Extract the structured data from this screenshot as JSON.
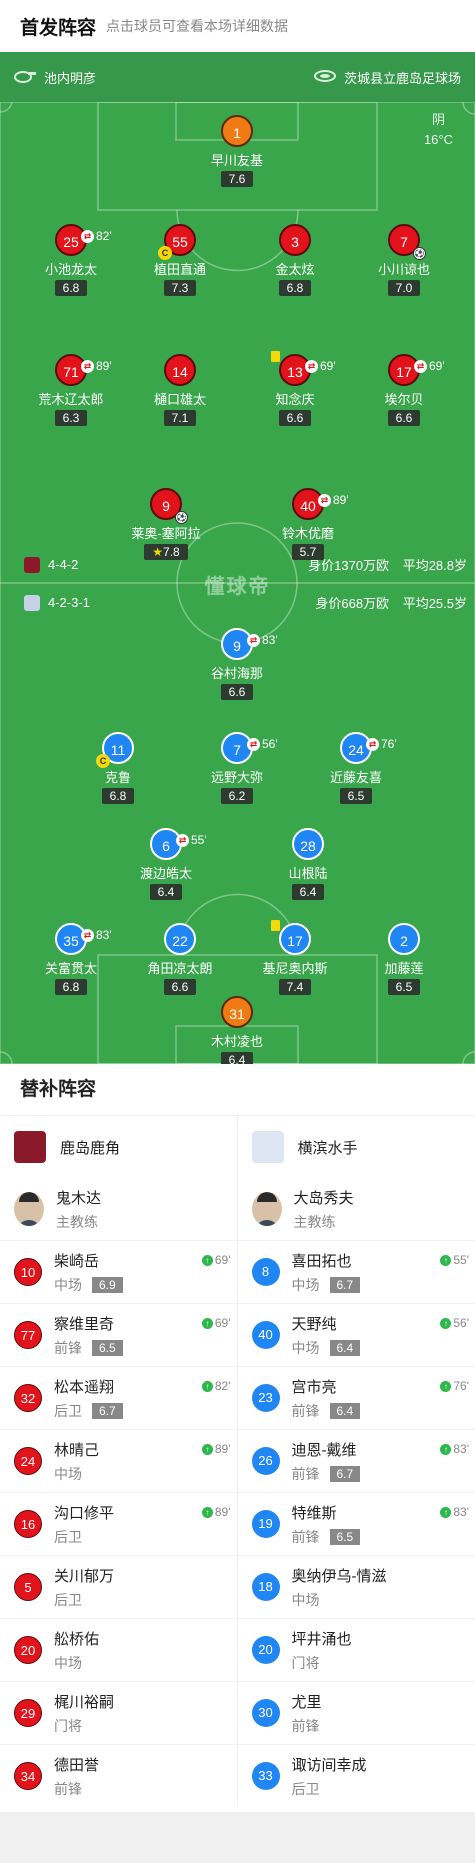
{
  "header": {
    "title": "首发阵容",
    "subtitle": "点击球员可查看本场详细数据"
  },
  "venue": {
    "referee": "池内明彦",
    "stadium": "茨城县立鹿岛足球场"
  },
  "weather": {
    "condition": "阴",
    "temp": "16°C"
  },
  "watermark": "懂球帝",
  "home_form": {
    "formation": "4-4-2",
    "value": "身价1370万欧",
    "age": "平均28.8岁"
  },
  "away_form": {
    "formation": "4-2-3-1",
    "value": "身价668万欧",
    "age": "平均25.5岁"
  },
  "home_players": [
    {
      "num": "1",
      "name": "早川友基",
      "rating": "7.6",
      "sub": ""
    },
    {
      "num": "25",
      "name": "小池龙太",
      "rating": "6.8",
      "sub": "82'"
    },
    {
      "num": "55",
      "name": "植田直通",
      "rating": "7.3",
      "sub": ""
    },
    {
      "num": "3",
      "name": "金太炫",
      "rating": "6.8",
      "sub": ""
    },
    {
      "num": "7",
      "name": "小川谅也",
      "rating": "7.0",
      "sub": ""
    },
    {
      "num": "71",
      "name": "荒木辽太郎",
      "rating": "6.3",
      "sub": "89'"
    },
    {
      "num": "14",
      "name": "樋口雄太",
      "rating": "7.1",
      "sub": ""
    },
    {
      "num": "13",
      "name": "知念庆",
      "rating": "6.6",
      "sub": "69'"
    },
    {
      "num": "17",
      "name": "埃尔贝",
      "rating": "6.6",
      "sub": "69'"
    },
    {
      "num": "9",
      "name": "莱奥-塞阿拉",
      "rating": "7.8",
      "sub": ""
    },
    {
      "num": "40",
      "name": "铃木优磨",
      "rating": "5.7",
      "sub": "89'"
    }
  ],
  "away_players": [
    {
      "num": "9",
      "name": "谷村海那",
      "rating": "6.6",
      "sub": "83'"
    },
    {
      "num": "11",
      "name": "克鲁",
      "rating": "6.8",
      "sub": ""
    },
    {
      "num": "7",
      "name": "远野大弥",
      "rating": "6.2",
      "sub": "56'"
    },
    {
      "num": "24",
      "name": "近藤友喜",
      "rating": "6.5",
      "sub": "76'"
    },
    {
      "num": "6",
      "name": "渡边皓太",
      "rating": "6.4",
      "sub": "55'"
    },
    {
      "num": "28",
      "name": "山根陆",
      "rating": "6.4",
      "sub": ""
    },
    {
      "num": "35",
      "name": "关富贯太",
      "rating": "6.8",
      "sub": "83'"
    },
    {
      "num": "22",
      "name": "角田凉太朗",
      "rating": "6.6",
      "sub": ""
    },
    {
      "num": "17",
      "name": "基尼奥内斯",
      "rating": "7.4",
      "sub": ""
    },
    {
      "num": "2",
      "name": "加藤莲",
      "rating": "6.5",
      "sub": ""
    },
    {
      "num": "31",
      "name": "木村凌也",
      "rating": "6.4",
      "sub": ""
    }
  ],
  "subs": {
    "title": "替补阵容",
    "home": {
      "team": "鹿岛鹿角",
      "coach": {
        "name": "鬼木达",
        "role": "主教练"
      },
      "players": [
        {
          "num": "10",
          "name": "柴崎岳",
          "pos": "中场",
          "rating": "6.9",
          "in": "69'"
        },
        {
          "num": "77",
          "name": "察维里奇",
          "pos": "前锋",
          "rating": "6.5",
          "in": "69'"
        },
        {
          "num": "32",
          "name": "松本遥翔",
          "pos": "后卫",
          "rating": "6.7",
          "in": "82'"
        },
        {
          "num": "24",
          "name": "林晴己",
          "pos": "中场",
          "rating": "",
          "in": "89'"
        },
        {
          "num": "16",
          "name": "沟口修平",
          "pos": "后卫",
          "rating": "",
          "in": "89'"
        },
        {
          "num": "5",
          "name": "关川郁万",
          "pos": "后卫",
          "rating": "",
          "in": ""
        },
        {
          "num": "20",
          "name": "舩桥佑",
          "pos": "中场",
          "rating": "",
          "in": ""
        },
        {
          "num": "29",
          "name": "梶川裕嗣",
          "pos": "门将",
          "rating": "",
          "in": ""
        },
        {
          "num": "34",
          "name": "德田誉",
          "pos": "前锋",
          "rating": "",
          "in": ""
        }
      ]
    },
    "away": {
      "team": "横滨水手",
      "coach": {
        "name": "大岛秀夫",
        "role": "主教练"
      },
      "players": [
        {
          "num": "8",
          "name": "喜田拓也",
          "pos": "中场",
          "rating": "6.7",
          "in": "55'"
        },
        {
          "num": "40",
          "name": "天野纯",
          "pos": "中场",
          "rating": "6.4",
          "in": "56'"
        },
        {
          "num": "23",
          "name": "宫市亮",
          "pos": "前锋",
          "rating": "6.4",
          "in": "76'"
        },
        {
          "num": "26",
          "name": "迪恩-戴维",
          "pos": "前锋",
          "rating": "6.7",
          "in": "83'"
        },
        {
          "num": "19",
          "name": "特维斯",
          "pos": "前锋",
          "rating": "6.5",
          "in": "83'"
        },
        {
          "num": "18",
          "name": "奥纳伊乌-情滋",
          "pos": "中场",
          "rating": "",
          "in": ""
        },
        {
          "num": "20",
          "name": "坪井涌也",
          "pos": "门将",
          "rating": "",
          "in": ""
        },
        {
          "num": "30",
          "name": "尤里",
          "pos": "前锋",
          "rating": "",
          "in": ""
        },
        {
          "num": "33",
          "name": "诹访间幸成",
          "pos": "后卫",
          "rating": "",
          "in": ""
        }
      ]
    }
  },
  "colors": {
    "pitch": "#3aa64c",
    "home": "#e3131b",
    "away": "#1f86f4",
    "keeper": "#f07a13"
  }
}
